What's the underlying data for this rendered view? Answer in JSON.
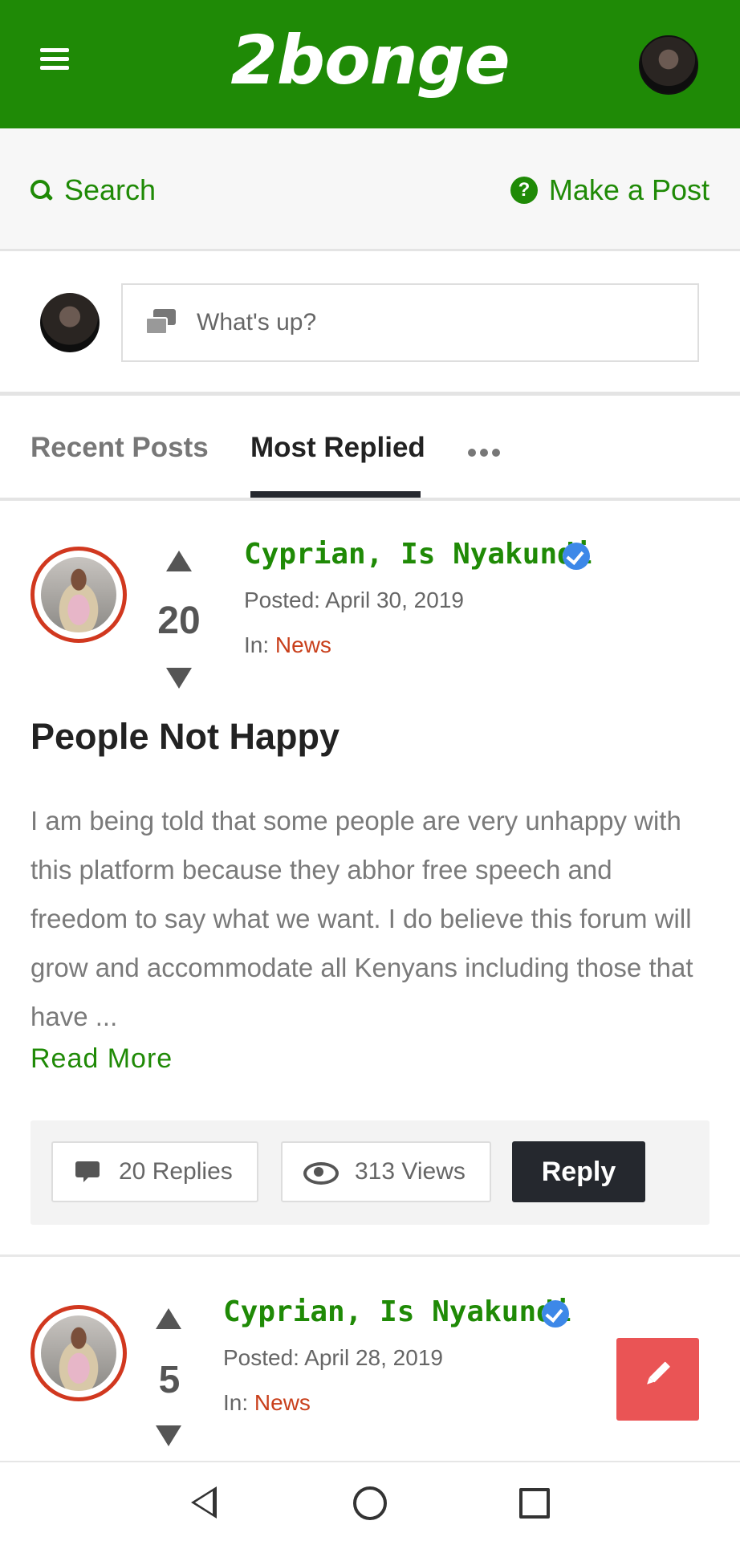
{
  "header": {
    "logo": "2bonge"
  },
  "toolbar": {
    "search_label": "Search",
    "help_glyph": "?",
    "make_post_label": "Make a Post"
  },
  "composer": {
    "placeholder": "What's up?"
  },
  "tabs": [
    {
      "label": "Recent Posts",
      "active": false
    },
    {
      "label": "Most Replied",
      "active": true
    }
  ],
  "posts": [
    {
      "author": "Cyprian, Is Nyakundi",
      "verified": true,
      "votes": "20",
      "posted": "Posted: April 30, 2019",
      "in_label": "In: ",
      "category": "News",
      "title": "People Not Happy",
      "body": "I am being told that some people are very unhappy with this platform because they abhor free speech and freedom to say what we want. I do believe this forum will grow and accommodate all Kenyans including those that have ...",
      "read_more": "Read More",
      "replies": "20 Replies",
      "views": "313 Views",
      "reply_label": "Reply"
    },
    {
      "author": "Cyprian, Is Nyakundi",
      "verified": true,
      "votes": "5",
      "posted": "Posted: April 28, 2019",
      "in_label": "In: ",
      "category": "News"
    }
  ],
  "colors": {
    "brand": "#1f8a06",
    "category": "#c9401c",
    "fab": "#ea5455",
    "verified": "#3d88e8"
  }
}
